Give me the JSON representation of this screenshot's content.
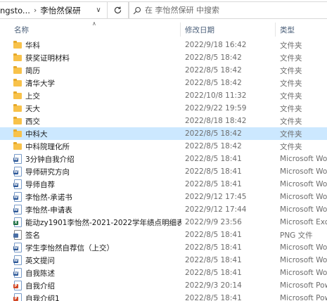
{
  "addressbar": {
    "crumbs": [
      "ngsto...",
      "李怡然保研"
    ],
    "separator": "›",
    "dropdown_icon": "chevron-down-icon",
    "refresh_icon": "refresh-icon"
  },
  "search": {
    "placeholder": "在 李怡然保研 中搜索",
    "icon": "search-icon"
  },
  "columns": {
    "name": "名称",
    "date": "修改日期",
    "type": "类型"
  },
  "files": [
    {
      "name": "华科",
      "date": "2022/9/18 16:42",
      "type": "文件夹",
      "icon": "folder"
    },
    {
      "name": "获奖证明材料",
      "date": "2022/8/5 18:42",
      "type": "文件夹",
      "icon": "folder"
    },
    {
      "name": "简历",
      "date": "2022/8/5 18:42",
      "type": "文件夹",
      "icon": "folder"
    },
    {
      "name": "清华大学",
      "date": "2022/8/5 18:42",
      "type": "文件夹",
      "icon": "folder"
    },
    {
      "name": "上交",
      "date": "2022/10/8 11:32",
      "type": "文件夹",
      "icon": "folder"
    },
    {
      "name": "天大",
      "date": "2022/9/22 19:59",
      "type": "文件夹",
      "icon": "folder"
    },
    {
      "name": "西交",
      "date": "2022/8/18 18:42",
      "type": "文件夹",
      "icon": "folder"
    },
    {
      "name": "中科大",
      "date": "2022/8/5 18:42",
      "type": "文件夹",
      "icon": "folder",
      "selected": true
    },
    {
      "name": "中科院理化所",
      "date": "2022/8/5 18:42",
      "type": "文件夹",
      "icon": "folder"
    },
    {
      "name": "3分钟自我介绍",
      "date": "2022/8/5 18:41",
      "type": "Microsoft Word",
      "icon": "word"
    },
    {
      "name": "导师研究方向",
      "date": "2022/8/5 18:41",
      "type": "Microsoft Word",
      "icon": "word"
    },
    {
      "name": "导师自荐",
      "date": "2022/8/5 18:41",
      "type": "Microsoft Word",
      "icon": "word"
    },
    {
      "name": "李怡然-承诺书",
      "date": "2022/9/12 17:45",
      "type": "Microsoft Word",
      "icon": "word"
    },
    {
      "name": "李怡然-申请表",
      "date": "2022/9/12 17:44",
      "type": "Microsoft Word",
      "icon": "word"
    },
    {
      "name": "能动zy1901李怡然-2021-2022学年绩点明细表",
      "date": "2022/9/9 23:56",
      "type": "Microsoft Excel",
      "icon": "excel"
    },
    {
      "name": "签名",
      "date": "2022/8/5 18:41",
      "type": "PNG 文件",
      "icon": "png"
    },
    {
      "name": "学生李怡然自荐信（上交）",
      "date": "2022/8/5 18:41",
      "type": "Microsoft Word",
      "icon": "word"
    },
    {
      "name": "英文提问",
      "date": "2022/8/5 18:41",
      "type": "Microsoft Word",
      "icon": "word"
    },
    {
      "name": "自我陈述",
      "date": "2022/8/5 18:41",
      "type": "Microsoft Word",
      "icon": "word"
    },
    {
      "name": "自我介绍",
      "date": "2022/9/3 20:14",
      "type": "Microsoft PowerPoint",
      "icon": "ppt"
    },
    {
      "name": "自我介绍1",
      "date": "2022/8/5 18:41",
      "type": "Microsoft PowerPoint",
      "icon": "ppt"
    }
  ],
  "colors": {
    "selected_row": "#cce8ff",
    "folder": "#f8c24a",
    "word": "#2b5797",
    "excel": "#1e7145",
    "ppt": "#d24726"
  }
}
